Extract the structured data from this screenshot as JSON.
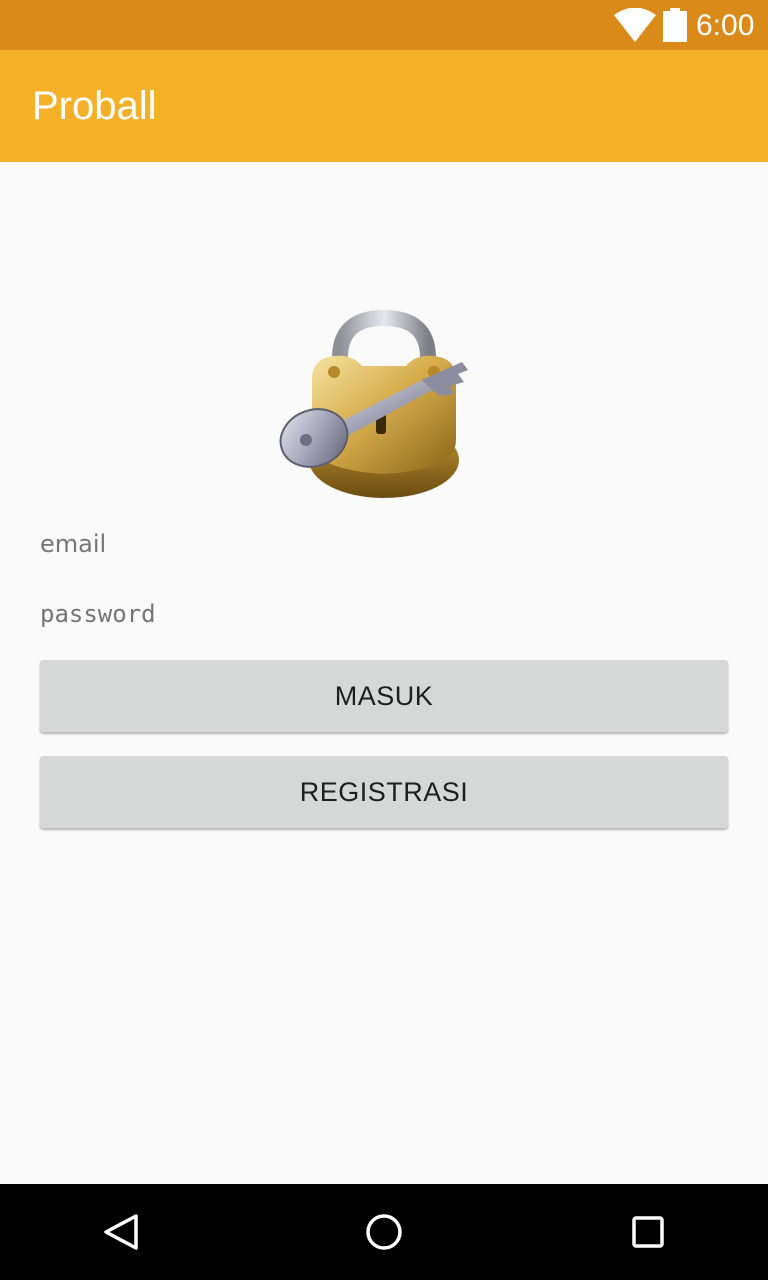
{
  "status_bar": {
    "time": "6:00",
    "icons": [
      "wifi-icon",
      "battery-icon"
    ]
  },
  "app_bar": {
    "title": "Proball",
    "color": "#f4b027"
  },
  "login": {
    "image": "padlock-with-key",
    "email_hint": "email",
    "password_hint": "password",
    "login_button": "MASUK",
    "register_button": "REGISTRASI"
  },
  "nav_bar": {
    "icons": [
      "back-icon",
      "home-icon",
      "recent-apps-icon"
    ]
  },
  "colors": {
    "status_bar": "#da8a19",
    "accent": "#f4b027",
    "button": "#d6d7d7",
    "background": "#fafafa"
  }
}
